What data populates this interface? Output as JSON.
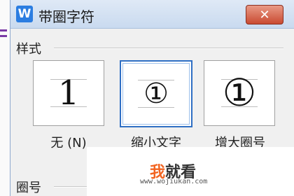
{
  "dialog": {
    "title": "带圈字符",
    "app_icon_letter": "W",
    "close_label": "✕"
  },
  "style_group": {
    "label": "样式",
    "options": [
      {
        "glyph": "1",
        "caption": "无 (N)",
        "selected": false
      },
      {
        "glyph": "①",
        "caption": "缩小文字",
        "selected": true
      },
      {
        "glyph": "①",
        "caption": "增大圈号",
        "selected": false
      }
    ]
  },
  "circle_group": {
    "label": "圈号"
  },
  "watermark": {
    "brand_first": "我",
    "brand_rest": "就看",
    "url": "www.wojiukan.com"
  },
  "colors": {
    "accent": "#2f6fc4",
    "close": "#c94a31",
    "brand": "#f26522"
  }
}
